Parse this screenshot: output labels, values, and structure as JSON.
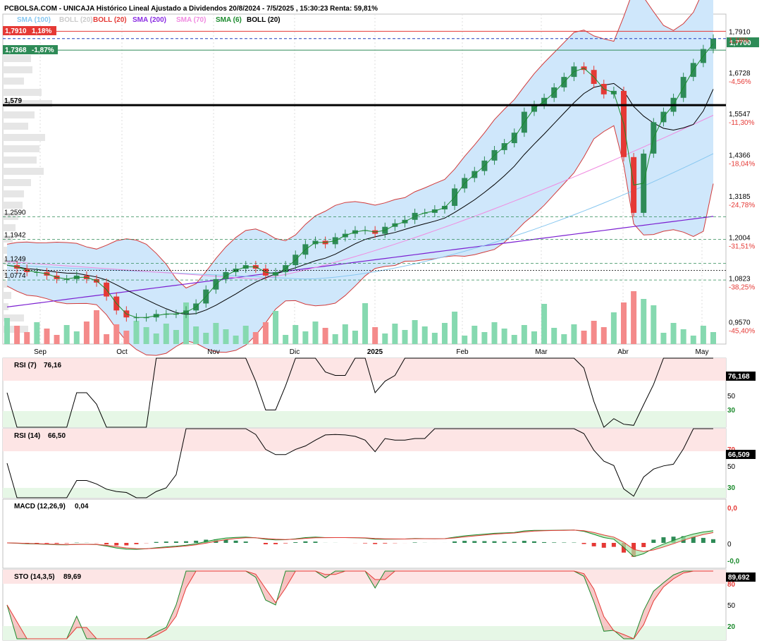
{
  "header": {
    "title": "PCBOLSA.COM - UNICAJA Histórico Lineal Ajustado a Dividendos 20/8/2024 - 7/5/2025 , 15:30:23 Renta: 59,81%",
    "legend": [
      {
        "label": "SMA (100)",
        "color": "#87c7f0"
      },
      {
        "label": "BOLL (20)",
        "color": "#cccccc"
      },
      {
        "label": "BOLL (20)",
        "color": "#e53935"
      },
      {
        "label": "SMA (200)",
        "color": "#8a2be2"
      },
      {
        "label": "SMA (70)",
        "color": "#f08ae0"
      },
      {
        "label": "SMA (6)",
        "color": "#1b8a2c"
      },
      {
        "label": "BOLL (20)",
        "color": "#000000"
      }
    ]
  },
  "price_tags": {
    "upper": {
      "price": "1,7910",
      "change": "1,18%",
      "color": "#e53935"
    },
    "lower": {
      "price": "1,7368",
      "change": "-1,87%",
      "color": "#2e8b57"
    },
    "last": {
      "price": "1,7700",
      "color": "#2e8b57"
    }
  },
  "levels": {
    "support_main": "1,579",
    "l1": "1,2590",
    "l2": "1,1942",
    "l3": "1,1249",
    "l4": "1,0774"
  },
  "right_axis": [
    {
      "value": "1,7910",
      "pct": "1,18%"
    },
    {
      "value": "1,6728",
      "pct": "-4,56%"
    },
    {
      "value": "1,5547",
      "pct": "-11,30%"
    },
    {
      "value": "1,4366",
      "pct": "-18,04%"
    },
    {
      "value": "1,3185",
      "pct": "-24,78%"
    },
    {
      "value": "1,2004",
      "pct": "-31,51%"
    },
    {
      "value": "1,0823",
      "pct": "-38,25%"
    },
    {
      "value": "0,9570",
      "pct": "-45,40%"
    }
  ],
  "months": [
    "Sep",
    "Oct",
    "Nov",
    "Dic",
    "2025",
    "Feb",
    "Mar",
    "Abr",
    "May"
  ],
  "panels": {
    "rsi7": {
      "title": "RSI (7)",
      "value": "76,16",
      "tag": "76,168",
      "levels": [
        "50",
        "30"
      ]
    },
    "rsi14": {
      "title": "RSI (14)",
      "value": "66,50",
      "tag": "66,509",
      "levels": [
        "70",
        "50",
        "30"
      ]
    },
    "macd": {
      "title": "MACD (12,26,9)",
      "value": "0,04",
      "levels": [
        "0,0",
        "0",
        "-0,0"
      ]
    },
    "sto": {
      "title": "STO (14,3,5)",
      "value": "89,69",
      "tag": "89,692",
      "levels": [
        "80",
        "50",
        "20"
      ]
    }
  },
  "chart_data": {
    "type": "line",
    "title": "PCBOLSA.COM - UNICAJA Histórico Lineal Ajustado a Dividendos 20/8/2024 - 7/5/2025 , 15:30:23 Renta: 59,81%",
    "x_months": [
      "Sep",
      "Oct",
      "Nov",
      "Dic",
      "2025",
      "Feb",
      "Mar",
      "Abr",
      "May"
    ],
    "ylim": [
      0.93,
      1.82
    ],
    "close_approx": [
      1.12,
      1.11,
      1.1,
      1.1,
      1.09,
      1.08,
      1.08,
      1.09,
      1.08,
      1.07,
      1.03,
      0.99,
      0.97,
      0.97,
      0.97,
      0.98,
      0.98,
      0.98,
      0.99,
      1.01,
      1.05,
      1.08,
      1.1,
      1.11,
      1.12,
      1.11,
      1.09,
      1.1,
      1.12,
      1.15,
      1.18,
      1.19,
      1.18,
      1.2,
      1.21,
      1.22,
      1.22,
      1.21,
      1.23,
      1.24,
      1.25,
      1.27,
      1.27,
      1.28,
      1.29,
      1.34,
      1.37,
      1.39,
      1.42,
      1.45,
      1.47,
      1.5,
      1.56,
      1.58,
      1.6,
      1.63,
      1.66,
      1.69,
      1.68,
      1.64,
      1.61,
      1.62,
      1.43,
      1.27,
      1.44,
      1.53,
      1.56,
      1.6,
      1.66,
      1.7,
      1.74,
      1.77
    ],
    "levels": [
      1.579,
      1.259,
      1.1942,
      1.1249,
      1.0774
    ],
    "last": 1.77
  }
}
